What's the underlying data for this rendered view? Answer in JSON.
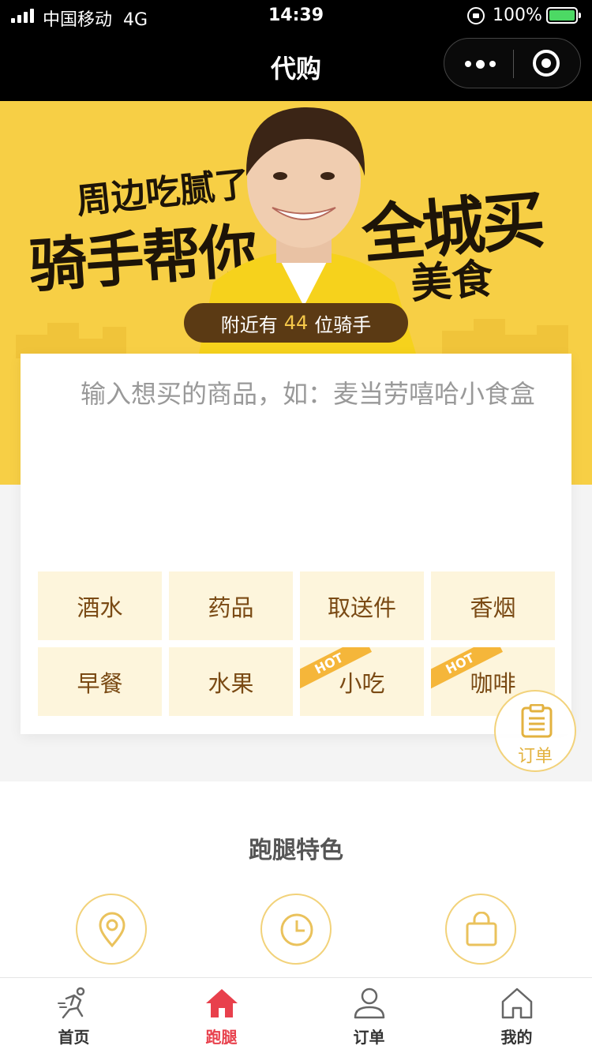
{
  "status_bar": {
    "carrier": "中国移动",
    "network": "4G",
    "time": "14:39",
    "battery_percent": "100%"
  },
  "nav": {
    "title": "代购"
  },
  "banner": {
    "line1": "周边吃腻了",
    "line2": "骑手帮你",
    "line3": "全城买",
    "line4": "美食",
    "riders_prefix": "附近有",
    "riders_count": "44",
    "riders_suffix": "位骑手",
    "colors": {
      "background": "#f7cf45",
      "pill": "#5b3a14",
      "pill_number": "#f5c84a"
    }
  },
  "input": {
    "placeholder": "输入想买的商品，如：麦当劳嘻哈小食盒"
  },
  "categories": [
    {
      "label": "酒水"
    },
    {
      "label": "药品"
    },
    {
      "label": "取送件"
    },
    {
      "label": "香烟"
    },
    {
      "label": "早餐"
    },
    {
      "label": "水果"
    },
    {
      "label": "小吃",
      "badge": "HOT"
    },
    {
      "label": "咖啡",
      "badge": "HOT"
    }
  ],
  "order_button": {
    "label": "订单",
    "icon": "clipboard-icon"
  },
  "features": {
    "heading": "跑腿特色",
    "icons": [
      "location-pin-icon",
      "clock-icon",
      "shopping-bag-icon"
    ]
  },
  "tabbar": {
    "items": [
      {
        "label": "首页",
        "icon": "runner-icon",
        "active": false
      },
      {
        "label": "跑腿",
        "icon": "home-icon",
        "active": true
      },
      {
        "label": "订单",
        "icon": "user-icon",
        "active": false
      },
      {
        "label": "我的",
        "icon": "house-outline-icon",
        "active": false
      }
    ],
    "active_color": "#e8404c"
  }
}
